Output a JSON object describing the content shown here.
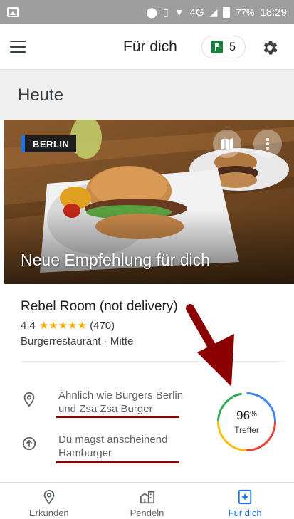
{
  "status_bar": {
    "network": "4G",
    "battery": "77%",
    "time": "18:29"
  },
  "app_bar": {
    "title": "Für dich",
    "saved_count": "5",
    "menu_icon": "hamburger-menu-icon",
    "saved_icon": "green-flag-icon",
    "settings_icon": "gear-icon"
  },
  "section": {
    "title": "Heute"
  },
  "card": {
    "city_badge": "BERLIN",
    "headline": "Neue Empfehlung für dich",
    "place_name": "Rebel Room (not delivery)",
    "rating": "4,4",
    "stars": "★★★★★",
    "review_count": "(470)",
    "category": "Burgerrestaurant · Mitte",
    "reasons": [
      {
        "icon": "location-pin-icon",
        "line1": "Ähnlich wie Burgers Berlin",
        "line2": "und Zsa Zsa Burger"
      },
      {
        "icon": "arrow-up-circle-icon",
        "line1": "Du magst anscheinend",
        "line2": "Hamburger"
      }
    ],
    "match": {
      "value": "96",
      "unit": "%",
      "label": "Treffer",
      "fraction": 0.96
    }
  },
  "bottom_nav": [
    {
      "label": "Erkunden",
      "icon": "location-pin-icon"
    },
    {
      "label": "Pendeln",
      "icon": "buildings-icon"
    },
    {
      "label": "Für dich",
      "icon": "sparkle-card-icon",
      "active": true
    }
  ],
  "colors": {
    "accent_blue": "#1a73e8",
    "star_yellow": "#f9ab00",
    "annotation_red": "#8b0000",
    "flag_green": "#188038"
  }
}
